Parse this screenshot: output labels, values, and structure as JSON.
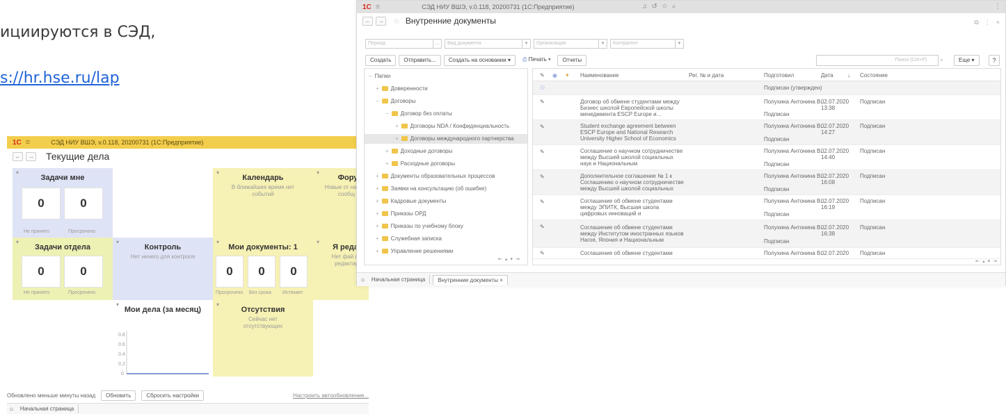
{
  "slide": {
    "line1": "ициируются в СЭД,",
    "line2": "s://hr.hse.ru/lap"
  },
  "back_window": {
    "logo": "1С",
    "title": "СЭД НИУ ВШЭ, v.0.118, 20200731  (1С:Предприятие)",
    "page_title": "Текущие дела",
    "tiles": {
      "my_tasks": {
        "title": "Задачи мне",
        "counts": [
          "0",
          "0"
        ],
        "labels": [
          "Не принято",
          "Просрочено"
        ]
      },
      "calendar": {
        "title": "Календарь",
        "sub": "В ближайшее время нет событий"
      },
      "forum": {
        "title": "Фору",
        "sub": "Новые от на мои сообщ"
      },
      "dept_tasks": {
        "title": "Задачи отдела",
        "counts": [
          "0",
          "0"
        ],
        "labels": [
          "Не принято",
          "Просрочено"
        ]
      },
      "control": {
        "title": "Контроль",
        "sub": "Нет ничего для контроля"
      },
      "my_docs": {
        "title": "Мои документы: 1",
        "counts": [
          "0",
          "0",
          "0"
        ],
        "labels": [
          "Просрочено",
          "Без срока",
          "Истекает"
        ]
      },
      "editing": {
        "title": "Я редакт",
        "sub": "Нет фай на редактир"
      },
      "my_affairs": {
        "title": "Мои дела (за месяц)",
        "y_ticks": [
          "0.8",
          "0.6",
          "0.4",
          "0.2",
          "0"
        ]
      },
      "absences": {
        "title": "Отсутствия",
        "sub": "Сейчас нет отсутствующих"
      }
    },
    "footer": {
      "updated": "Обновлено меньше минуты назад",
      "refresh": "Обновить",
      "reset": "Сбросить настройки",
      "auto": "Настроить автообновление..."
    },
    "tab_home": "Начальная страница"
  },
  "front_window": {
    "logo": "1С",
    "title": "СЭД НИУ ВШЭ, v.0.118, 20200731  (1С:Предприятие)",
    "page_title": "Внутренние документы",
    "filters": [
      "Период",
      "Вид документа",
      "Организация",
      "Контрагент"
    ],
    "buttons": {
      "create": "Создать",
      "send": "Отправить...",
      "create_based": "Создать на основании",
      "print": "Печать",
      "reports": "Отчеты",
      "search_placeholder": "Поиск (Ctrl+F)",
      "more": "Еще",
      "help": "?"
    },
    "tree": [
      {
        "label": "Папки",
        "level": 0,
        "folder": false
      },
      {
        "label": "Доверенности",
        "level": 1,
        "folder": true
      },
      {
        "label": "Договоры",
        "level": 1,
        "folder": true
      },
      {
        "label": "Договор без оплаты",
        "level": 2,
        "folder": true
      },
      {
        "label": "Договоры NDA / Конфиденциальность",
        "level": 3,
        "folder": true
      },
      {
        "label": "Договоры международного партнерства",
        "level": 3,
        "folder": true,
        "selected": true
      },
      {
        "label": "Доходные договоры",
        "level": 2,
        "folder": true
      },
      {
        "label": "Расходные договоры",
        "level": 2,
        "folder": true
      },
      {
        "label": "Документы образовательных процессов",
        "level": 1,
        "folder": true
      },
      {
        "label": "Заявки на консультацию (об ошибке)",
        "level": 1,
        "folder": true
      },
      {
        "label": "Кадровые документы",
        "level": 1,
        "folder": true
      },
      {
        "label": "Приказы ОРД",
        "level": 1,
        "folder": true
      },
      {
        "label": "Приказы по учебному блоку",
        "level": 1,
        "folder": true
      },
      {
        "label": "Служебная записка",
        "level": 1,
        "folder": true
      },
      {
        "label": "Управление решениями",
        "level": 1,
        "folder": true
      }
    ],
    "grid": {
      "headers": {
        "name": "Наименование",
        "reg": "Рег. № и дата",
        "signed": "Подготовил",
        "date": "Дата",
        "status": "Состояние"
      },
      "filter_row": "Подписан (утвержден)",
      "rows": [
        {
          "name": [
            "Договор об обмене студентами между",
            "Бизнес школой Европейской школы",
            "менеджмента ESCP Europe и..."
          ],
          "author": "Полухина Антонина В...",
          "signed": "Подписан",
          "date": "02.07.2020",
          "time": "13:38",
          "status": "Подписан"
        },
        {
          "name": [
            "Student exchange agreement between",
            "ESCP Europe and National Research",
            "University Higher School of Economics"
          ],
          "author": "Полухина Антонина В...",
          "signed": "Подписан",
          "date": "02.07.2020",
          "time": "14:27",
          "status": "Подписан"
        },
        {
          "name": [
            "Соглашение о научном сотрудничестве",
            "между Высшей школой социальных",
            "наук и Национальным"
          ],
          "author": "Полухина Антонина В...",
          "signed": "Подписан",
          "date": "02.07.2020",
          "time": "14:40",
          "status": "Подписан"
        },
        {
          "name": [
            "Дополнительное соглашение № 1 к",
            "Соглашению о научном сотрудничестве",
            "между Высшей школой социальных"
          ],
          "author": "Полухина Антонина В...",
          "signed": "Подписан",
          "date": "02.07.2020",
          "time": "16:08",
          "status": "Подписан"
        },
        {
          "name": [
            "Соглашение об обмене студентами",
            "между ЭПИТК, Высшая школа",
            "цифровых инноваций и"
          ],
          "author": "Полухина Антонина В...",
          "signed": "Подписан",
          "date": "02.07.2020",
          "time": "16:19",
          "status": "Подписан"
        },
        {
          "name": [
            "Соглашение об обмене студентами",
            "между Институтом иностранных языков",
            "Нагоя, Япония и Национальным"
          ],
          "author": "Полухина Антонина В...",
          "signed": "Подписан",
          "date": "02.07.2020",
          "time": "16:38",
          "status": "Подписан"
        },
        {
          "name": [
            "Соглашение об обмене студентами"
          ],
          "author": "Полухина Антонина В...",
          "signed": "",
          "date": "02.07.2020",
          "time": "",
          "status": "Подписан"
        }
      ]
    },
    "tabs": {
      "home": "Начальная страница",
      "docs": "Внутренние документы"
    }
  }
}
